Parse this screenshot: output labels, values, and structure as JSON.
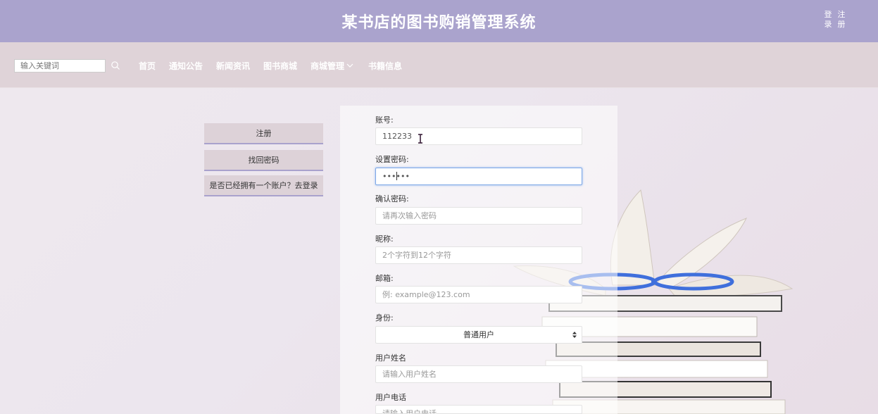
{
  "header": {
    "title": "某书店的图书购销管理系统",
    "login_label": "登录",
    "register_label": "注册"
  },
  "nav": {
    "search_placeholder": "输入关键词",
    "items": [
      "首页",
      "通知公告",
      "新闻资讯",
      "图书商城",
      "商城管理",
      "书籍信息"
    ]
  },
  "side_menu": {
    "register": "注册",
    "recover": "找回密码",
    "has_account": "是否已经拥有一个账户？去登录"
  },
  "form": {
    "account_label": "账号:",
    "account_value": "112233",
    "password_label": "设置密码:",
    "password_value": "••••••",
    "confirm_label": "确认密码:",
    "confirm_placeholder": "请再次输入密码",
    "nickname_label": "昵称:",
    "nickname_placeholder": "2个字符到12个字符",
    "email_label": "邮箱:",
    "email_placeholder": "例: example@123.com",
    "identity_label": "身份:",
    "identity_value": "普通用户",
    "username_label": "用户姓名",
    "username_placeholder": "请输入用户姓名",
    "phone_label": "用户电话",
    "phone_placeholder": "请输入用户电话"
  },
  "colors": {
    "header_bg": "#aaa3cd",
    "nav_bg": "#dfd3d8",
    "focus_border": "#7ea7e6"
  }
}
